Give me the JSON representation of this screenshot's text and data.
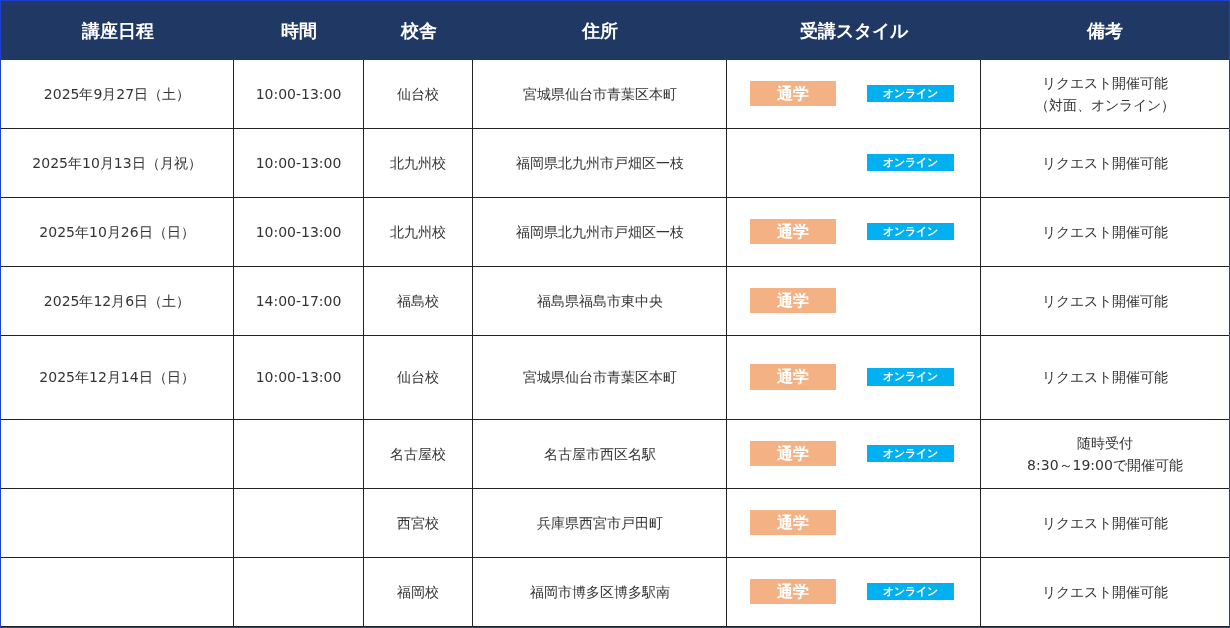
{
  "columns": [
    "講座日程",
    "時間",
    "校舎",
    "住所",
    "受講スタイル",
    "備考"
  ],
  "rows": [
    {
      "date": "2025年9月27日（土）",
      "time": "10:00-13:00",
      "school": "仙台校",
      "address": "宮城県仙台市青葉区本町",
      "in_person": "通学",
      "online": "オンライン",
      "note": [
        "リクエスト開催可能",
        "（対面、オンライン）"
      ]
    },
    {
      "date": "2025年10月13日（月祝）",
      "time": "10:00-13:00",
      "school": "北九州校",
      "address": "福岡県北九州市戸畑区一枝",
      "online": "オンライン",
      "note": [
        "リクエスト開催可能"
      ]
    },
    {
      "date": "2025年10月26日（日）",
      "time": "10:00-13:00",
      "school": "北九州校",
      "address": "福岡県北九州市戸畑区一枝",
      "in_person": "通学",
      "online": "オンライン",
      "note": [
        "リクエスト開催可能"
      ]
    },
    {
      "date": "2025年12月6日（土）",
      "time": "14:00-17:00",
      "school": "福島校",
      "address": "福島県福島市東中央",
      "in_person": "通学",
      "note": [
        "リクエスト開催可能"
      ]
    },
    {
      "date": "2025年12月14日（日）",
      "time": "10:00-13:00",
      "school": "仙台校",
      "address": "宮城県仙台市青葉区本町",
      "in_person": "通学",
      "online": "オンライン",
      "note": [
        "リクエスト開催可能"
      ]
    },
    {
      "school": "名古屋校",
      "address": "名古屋市西区名駅",
      "in_person": "通学",
      "online": "オンライン",
      "note": [
        "随時受付",
        "8:30～19:00で開催可能"
      ]
    },
    {
      "school": "西宮校",
      "address": "兵庫県西宮市戸田町",
      "in_person": "通学",
      "note": [
        "リクエスト開催可能"
      ]
    },
    {
      "school": "福岡校",
      "address": "福岡市博多区博多駅南",
      "in_person": "通学",
      "online": "オンライン",
      "note": [
        "リクエスト開催可能"
      ]
    }
  ]
}
